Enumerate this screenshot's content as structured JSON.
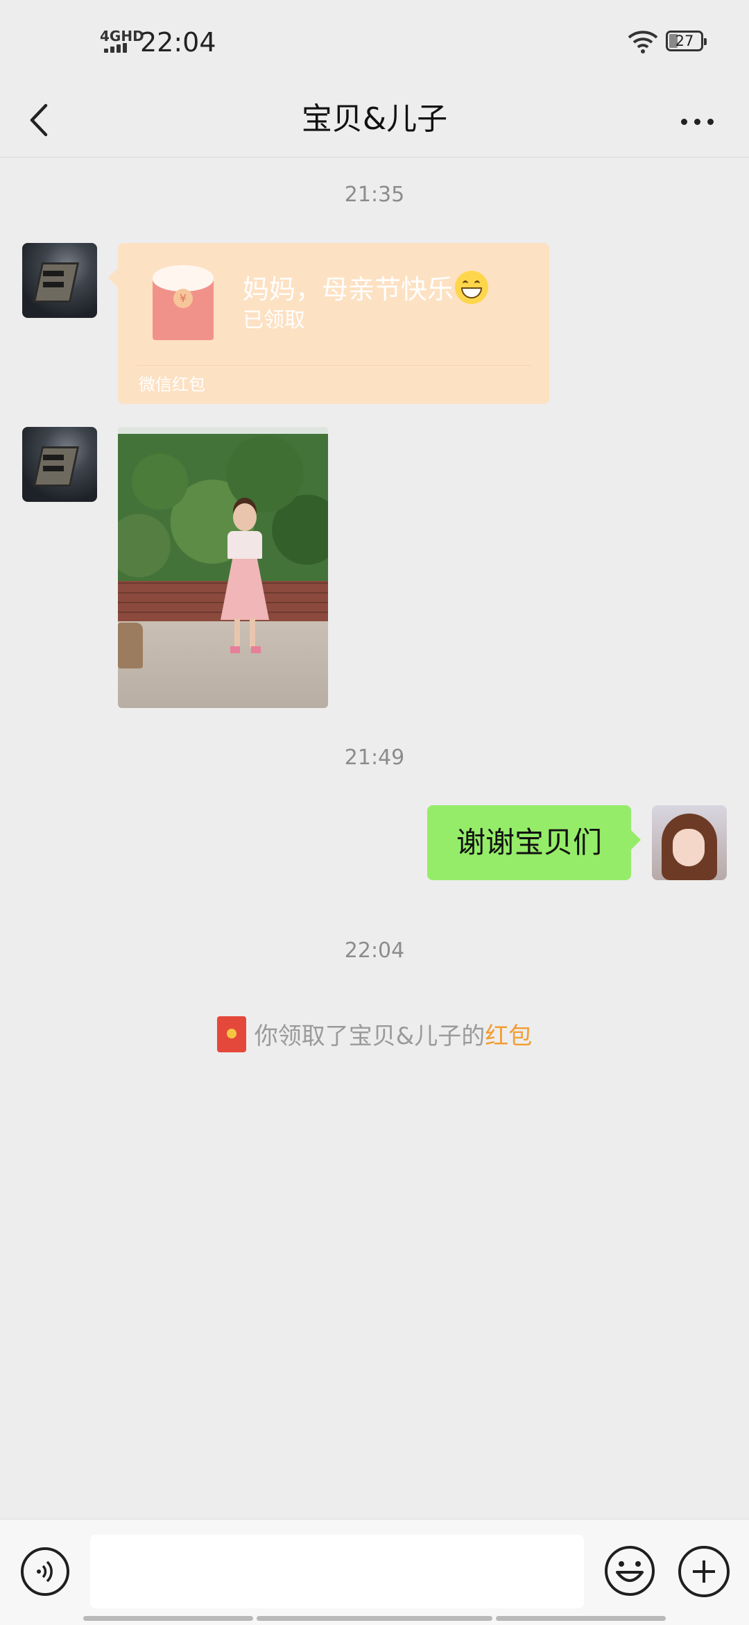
{
  "status_bar": {
    "network": "4GHD",
    "time": "22:04",
    "battery": "27"
  },
  "header": {
    "title": "宝贝&儿子",
    "back_icon": "back-arrow-icon",
    "more_icon": "more-dots-icon"
  },
  "messages": [
    {
      "type": "timestamp",
      "text": "21:35"
    },
    {
      "type": "red_packet",
      "sender": "contact",
      "title": "妈妈，母亲节快乐",
      "emoji": "grinning-face",
      "status": "已领取",
      "footer": "微信红包"
    },
    {
      "type": "image",
      "sender": "contact",
      "description": "photo of a girl in a pink dress"
    },
    {
      "type": "timestamp",
      "text": "21:49"
    },
    {
      "type": "text",
      "sender": "self",
      "text": "谢谢宝贝们"
    },
    {
      "type": "timestamp",
      "text": "22:04"
    },
    {
      "type": "system",
      "prefix": "你领取了宝贝&儿子的",
      "highlight": "红包"
    }
  ],
  "input_bar": {
    "placeholder": "",
    "voice_icon": "voice-icon",
    "emoji_icon": "emoji-icon",
    "plus_icon": "plus-icon"
  },
  "colors": {
    "background": "#ededed",
    "sent_bubble": "#95ec69",
    "red_packet": "#fde1c3",
    "highlight": "#f39c30"
  }
}
